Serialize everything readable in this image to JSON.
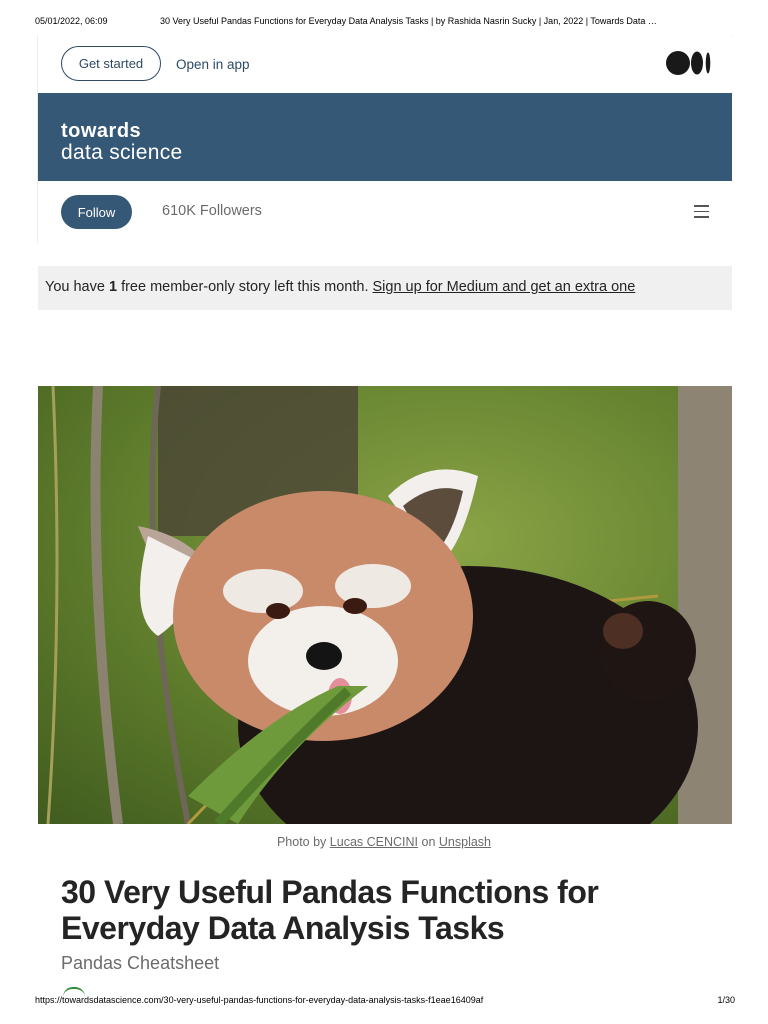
{
  "print_header": {
    "date": "05/01/2022, 06:09",
    "title": "30 Very Useful Pandas Functions for Everyday Data Analysis Tasks | by Rashida Nasrin Sucky | Jan, 2022 | Towards Data …"
  },
  "topbar": {
    "get_started": "Get started",
    "open_in_app": "Open in app",
    "logo_icon": "medium-logo-icon"
  },
  "publication": {
    "name_line1": "towards",
    "name_line2": "data science",
    "color": "#355876",
    "follow_label": "Follow",
    "followers": "610K Followers",
    "menu_icon": "hamburger-menu-icon"
  },
  "notice": {
    "prefix": "You have ",
    "count": "1",
    "middle": " free member-only story left this month. ",
    "link": "Sign up for Medium and get an extra one"
  },
  "hero": {
    "caption_prefix": "Photo by ",
    "photographer": "Lucas CENCINI",
    "caption_mid": " on ",
    "source": "Unsplash"
  },
  "article": {
    "title": "30 Very Useful Pandas Functions for Everyday Data Analysis Tasks",
    "subtitle": "Pandas Cheatsheet"
  },
  "print_footer": {
    "url": "https://towardsdatascience.com/30-very-useful-pandas-functions-for-everyday-data-analysis-tasks-f1eae16409af",
    "page": "1/30"
  }
}
